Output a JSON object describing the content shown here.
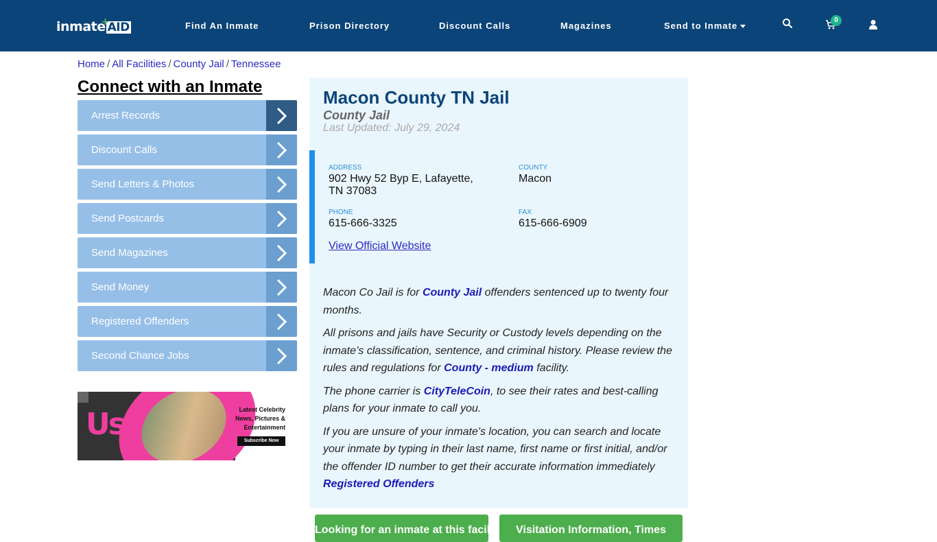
{
  "header": {
    "logo_text": "inmate",
    "logo_accent": "AID",
    "nav": [
      {
        "label": "Find An Inmate"
      },
      {
        "label": "Prison Directory"
      },
      {
        "label": "Discount Calls"
      },
      {
        "label": "Magazines"
      },
      {
        "label": "Send to Inmate"
      }
    ],
    "cart_count": "0",
    "icons": [
      "search-icon",
      "cart-icon",
      "user-icon"
    ]
  },
  "breadcrumb": [
    {
      "label": "Home"
    },
    {
      "label": "All Facilities"
    },
    {
      "label": "County Jail"
    },
    {
      "label": "Tennessee"
    }
  ],
  "breadcrumb_sep": "/",
  "sidebar": {
    "title": "Connect with an Inmate",
    "items": [
      {
        "label": "Arrest Records"
      },
      {
        "label": "Discount Calls"
      },
      {
        "label": "Send Letters & Photos"
      },
      {
        "label": "Send Postcards"
      },
      {
        "label": "Send Magazines"
      },
      {
        "label": "Send Money"
      },
      {
        "label": "Registered Offenders"
      },
      {
        "label": "Second Chance Jobs"
      }
    ]
  },
  "ad": {
    "brand": "Us",
    "headline": "Latest Celebrity News, Pictures & Entertainment",
    "cta": "Subscribe Now"
  },
  "facility": {
    "title": "Macon County TN Jail",
    "type": "County Jail",
    "last_updated": "Last Updated: July 29, 2024",
    "address_label": "ADDRESS",
    "address_line1": "902 Hwy 52 Byp E, Lafayette,",
    "address_line2": "TN 37083",
    "county_label": "COUNTY",
    "county": "Macon",
    "phone_label": "PHONE",
    "phone": "615-666-3325",
    "fax_label": "FAX",
    "fax": "615-666-6909",
    "website_link": "View Official Website"
  },
  "description": {
    "p1_a": "Macon Co Jail is for ",
    "p1_link": "County Jail",
    "p1_b": " offenders sentenced up to twenty four months.",
    "p2_a": "All prisons and jails have Security or Custody levels depending on the inmate’s classification, sentence, and criminal history. Please review the rules and regulations for ",
    "p2_link": "County - medium",
    "p2_b": " facility.",
    "p3_a": "The phone carrier is ",
    "p3_link": "CityTeleCoin",
    "p3_b": ", to see their rates and best-calling plans for your inmate to call you.",
    "p4_a": "If you are unsure of your inmate's location, you can search and locate your inmate by typing in their last name, first name or first initial, and/or the offender ID number to get their accurate information immediately ",
    "p4_link": "Registered Offenders"
  },
  "buttons": {
    "find_inmate": "Looking for an inmate at this facility?",
    "visitation": "Visitation Information, Times"
  },
  "colors": {
    "header_bg": "#0b4478",
    "sidebar_item": "#96bfe8",
    "sidebar_arrow": "#6b9fd0",
    "sidebar_arrow_active": "#2f5b87",
    "main_bg": "#eaf6fd",
    "accent_bar": "#1e90e8",
    "green_button": "#4cae4c",
    "badge": "#1fb58f"
  }
}
